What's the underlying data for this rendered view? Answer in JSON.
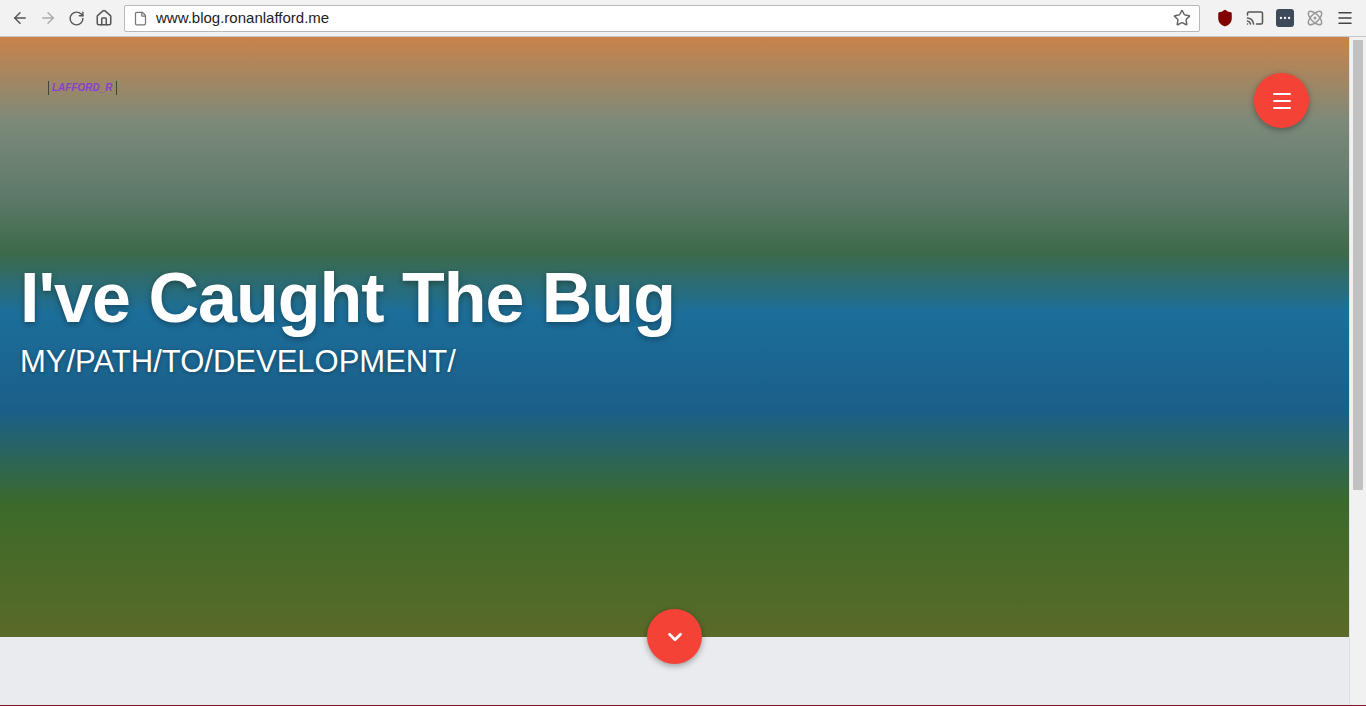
{
  "browser": {
    "url": "www.blog.ronanlafford.me"
  },
  "site": {
    "logo": "LAFFORD_R",
    "title": "I've Caught The Bug",
    "subtitle": "MY/PATH/TO/DEVELOPMENT/"
  }
}
